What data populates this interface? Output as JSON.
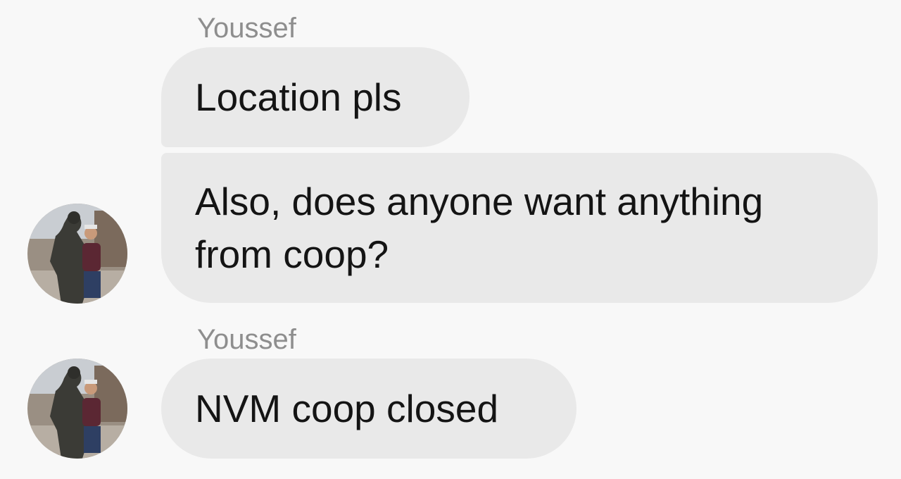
{
  "conversation": {
    "groups": [
      {
        "sender": "Youssef",
        "messages": [
          "Location pls",
          "Also, does anyone want anything from coop?"
        ]
      },
      {
        "sender": "Youssef",
        "messages": [
          "NVM coop closed"
        ]
      }
    ]
  },
  "colors": {
    "background": "#f8f8f8",
    "bubble": "#e9e9e9",
    "sender_name": "#8e8e8e",
    "message_text": "#141414"
  }
}
